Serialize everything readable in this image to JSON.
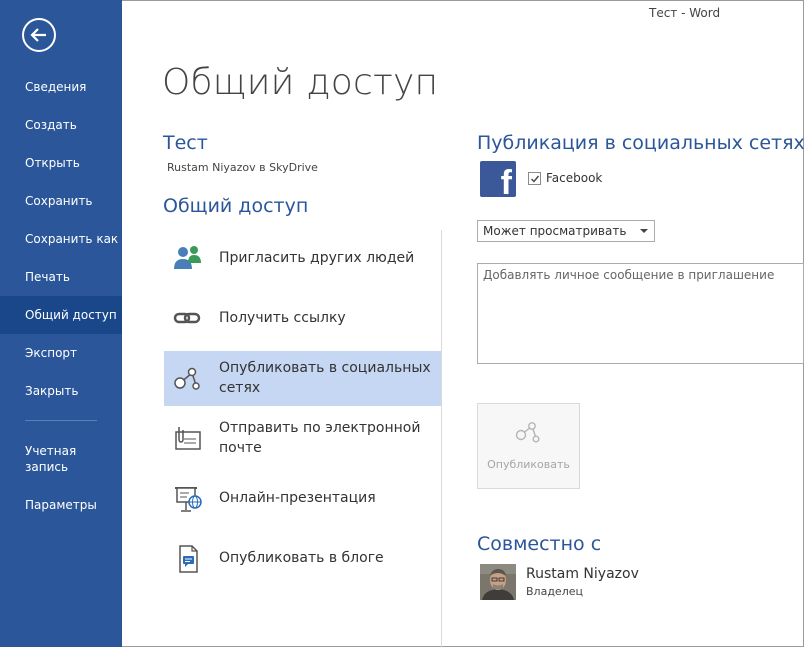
{
  "window": {
    "title": "Тест - Word"
  },
  "sidebar": {
    "items": [
      {
        "label": "Сведения"
      },
      {
        "label": "Создать"
      },
      {
        "label": "Открыть"
      },
      {
        "label": "Сохранить"
      },
      {
        "label": "Сохранить как"
      },
      {
        "label": "Печать"
      },
      {
        "label": "Общий доступ",
        "active": true
      },
      {
        "label": "Экспорт"
      },
      {
        "label": "Закрыть"
      },
      {
        "label": "Учетная запись"
      },
      {
        "label": "Параметры"
      }
    ]
  },
  "main": {
    "title": "Общий доступ",
    "document": {
      "name": "Тест",
      "location": "Rustam Niyazov в SkyDrive"
    },
    "section_title": "Общий доступ",
    "options": [
      {
        "label": "Пригласить других людей",
        "icon": "invite-people-icon"
      },
      {
        "label": "Получить ссылку",
        "icon": "link-icon"
      },
      {
        "label": "Опубликовать в социальных сетях",
        "icon": "social-network-icon",
        "active": true
      },
      {
        "label": "Отправить по электронной почте",
        "icon": "email-icon"
      },
      {
        "label": "Онлайн-презентация",
        "icon": "online-presentation-icon"
      },
      {
        "label": "Опубликовать в блоге",
        "icon": "blog-icon"
      }
    ]
  },
  "social": {
    "title": "Публикация в социальных сетях",
    "facebook_label": "Facebook",
    "facebook_checked": true,
    "permission_value": "Может просматривать",
    "message_placeholder": "Добавлять личное сообщение в приглашение",
    "publish_label": "Опубликовать"
  },
  "shared_with": {
    "title": "Совместно с",
    "user": {
      "name": "Rustam Niyazov",
      "role": "Владелец"
    }
  },
  "colors": {
    "accent": "#2b579a",
    "active_nav": "#19478a",
    "selected_option": "#c5d7f2",
    "facebook": "#3b5998"
  }
}
